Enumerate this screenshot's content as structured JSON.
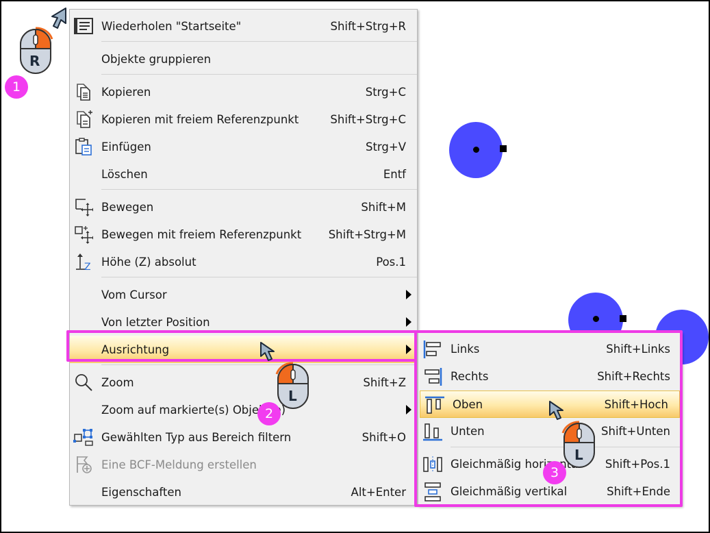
{
  "menu": {
    "items": [
      {
        "label": "Wiederholen \"Startseite\"",
        "shortcut": "Shift+Strg+R",
        "icon": "repeat-list-icon"
      },
      {
        "label": "Objekte gruppieren",
        "shortcut": "",
        "icon": ""
      },
      {
        "label": "Kopieren",
        "shortcut": "Strg+C",
        "icon": "copy-icon"
      },
      {
        "label": "Kopieren mit freiem Referenzpunkt",
        "shortcut": "Shift+Strg+C",
        "icon": "copy-reference-icon"
      },
      {
        "label": "Einfügen",
        "shortcut": "Strg+V",
        "icon": "paste-icon"
      },
      {
        "label": "Löschen",
        "shortcut": "Entf",
        "icon": ""
      },
      {
        "label": "Bewegen",
        "shortcut": "Shift+M",
        "icon": "move-icon"
      },
      {
        "label": "Bewegen mit freiem Referenzpunkt",
        "shortcut": "Shift+Strg+M",
        "icon": "move-reference-icon"
      },
      {
        "label": "Höhe (Z) absolut",
        "shortcut": "Pos.1",
        "icon": "height-z-icon"
      },
      {
        "label": "Vom Cursor",
        "shortcut": "",
        "icon": ""
      },
      {
        "label": "Von letzter Position",
        "shortcut": "",
        "icon": ""
      },
      {
        "label": "Ausrichtung",
        "shortcut": "",
        "icon": ""
      },
      {
        "label": "Zoom",
        "shortcut": "Shift+Z",
        "icon": "zoom-icon"
      },
      {
        "label": "Zoom auf markierte(s) Objekt(e)",
        "shortcut": "",
        "icon": ""
      },
      {
        "label": "Gewählten Typ aus Bereich filtern",
        "shortcut": "Shift+O",
        "icon": "filter-type-icon"
      },
      {
        "label": "Eine BCF-Meldung erstellen",
        "shortcut": "",
        "icon": "bcf-icon"
      },
      {
        "label": "Eigenschaften",
        "shortcut": "Alt+Enter",
        "icon": ""
      }
    ]
  },
  "submenu": {
    "items": [
      {
        "label": "Links",
        "shortcut": "Shift+Links",
        "icon": "align-left-icon"
      },
      {
        "label": "Rechts",
        "shortcut": "Shift+Rechts",
        "icon": "align-right-icon"
      },
      {
        "label": "Oben",
        "shortcut": "Shift+Hoch",
        "icon": "align-top-icon"
      },
      {
        "label": "Unten",
        "shortcut": "Shift+Unten",
        "icon": "align-bottom-icon"
      },
      {
        "label": "Gleichmäßig horizontal",
        "shortcut": "Shift+Pos.1",
        "icon": "distribute-horizontal-icon"
      },
      {
        "label": "Gleichmäßig vertikal",
        "shortcut": "Shift+Ende",
        "icon": "distribute-vertical-icon"
      }
    ]
  },
  "annotations": {
    "badge1": "1",
    "badge2": "2",
    "badge3": "3",
    "mouse_right": "R",
    "mouse_left_a": "L",
    "mouse_left_b": "L"
  },
  "colors": {
    "highlight_box": "#ee3be6",
    "badge": "#f23cf0",
    "canvas_circle": "#4a4aff",
    "mouse_button": "#f06a1e"
  }
}
